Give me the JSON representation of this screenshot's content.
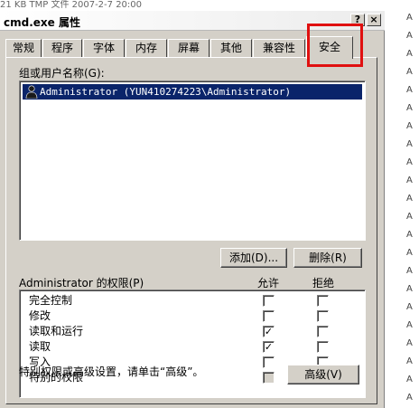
{
  "window": {
    "title": "cmd.exe 属性",
    "help_button": "?",
    "close_button": "×"
  },
  "background": {
    "top_line": "21 KB  TMP 文件          2007-2-7  20:00"
  },
  "tabs": [
    {
      "label": "常规"
    },
    {
      "label": "程序"
    },
    {
      "label": "字体"
    },
    {
      "label": "内存"
    },
    {
      "label": "屏幕"
    },
    {
      "label": "其他"
    },
    {
      "label": "兼容性"
    },
    {
      "label": "安全",
      "active": true
    }
  ],
  "security": {
    "group_label": "组或用户名称(G):",
    "users": [
      {
        "name": "Administrator (YUN410274223\\Administrator)",
        "selected": true
      }
    ],
    "add_button": "添加(D)...",
    "remove_button": "删除(R)",
    "perm_label": "Administrator 的权限(P)",
    "allow_header": "允许",
    "deny_header": "拒绝",
    "permissions": [
      {
        "name": "完全控制",
        "allow": false,
        "deny": false,
        "disabled": false
      },
      {
        "name": "修改",
        "allow": false,
        "deny": false,
        "disabled": false
      },
      {
        "name": "读取和运行",
        "allow": true,
        "deny": false,
        "disabled": false
      },
      {
        "name": "读取",
        "allow": true,
        "deny": false,
        "disabled": false
      },
      {
        "name": "写入",
        "allow": false,
        "deny": false,
        "disabled": false
      },
      {
        "name": "特别的权限",
        "allow": false,
        "deny": false,
        "disabled": true
      }
    ],
    "advanced_note": "特别权限或高级设置，请单击“高级”。",
    "advanced_button": "高级(V)"
  },
  "colors": {
    "dialog_bg": "#d4d0c8",
    "selection": "#0a246a",
    "highlight_box": "#e01010"
  }
}
